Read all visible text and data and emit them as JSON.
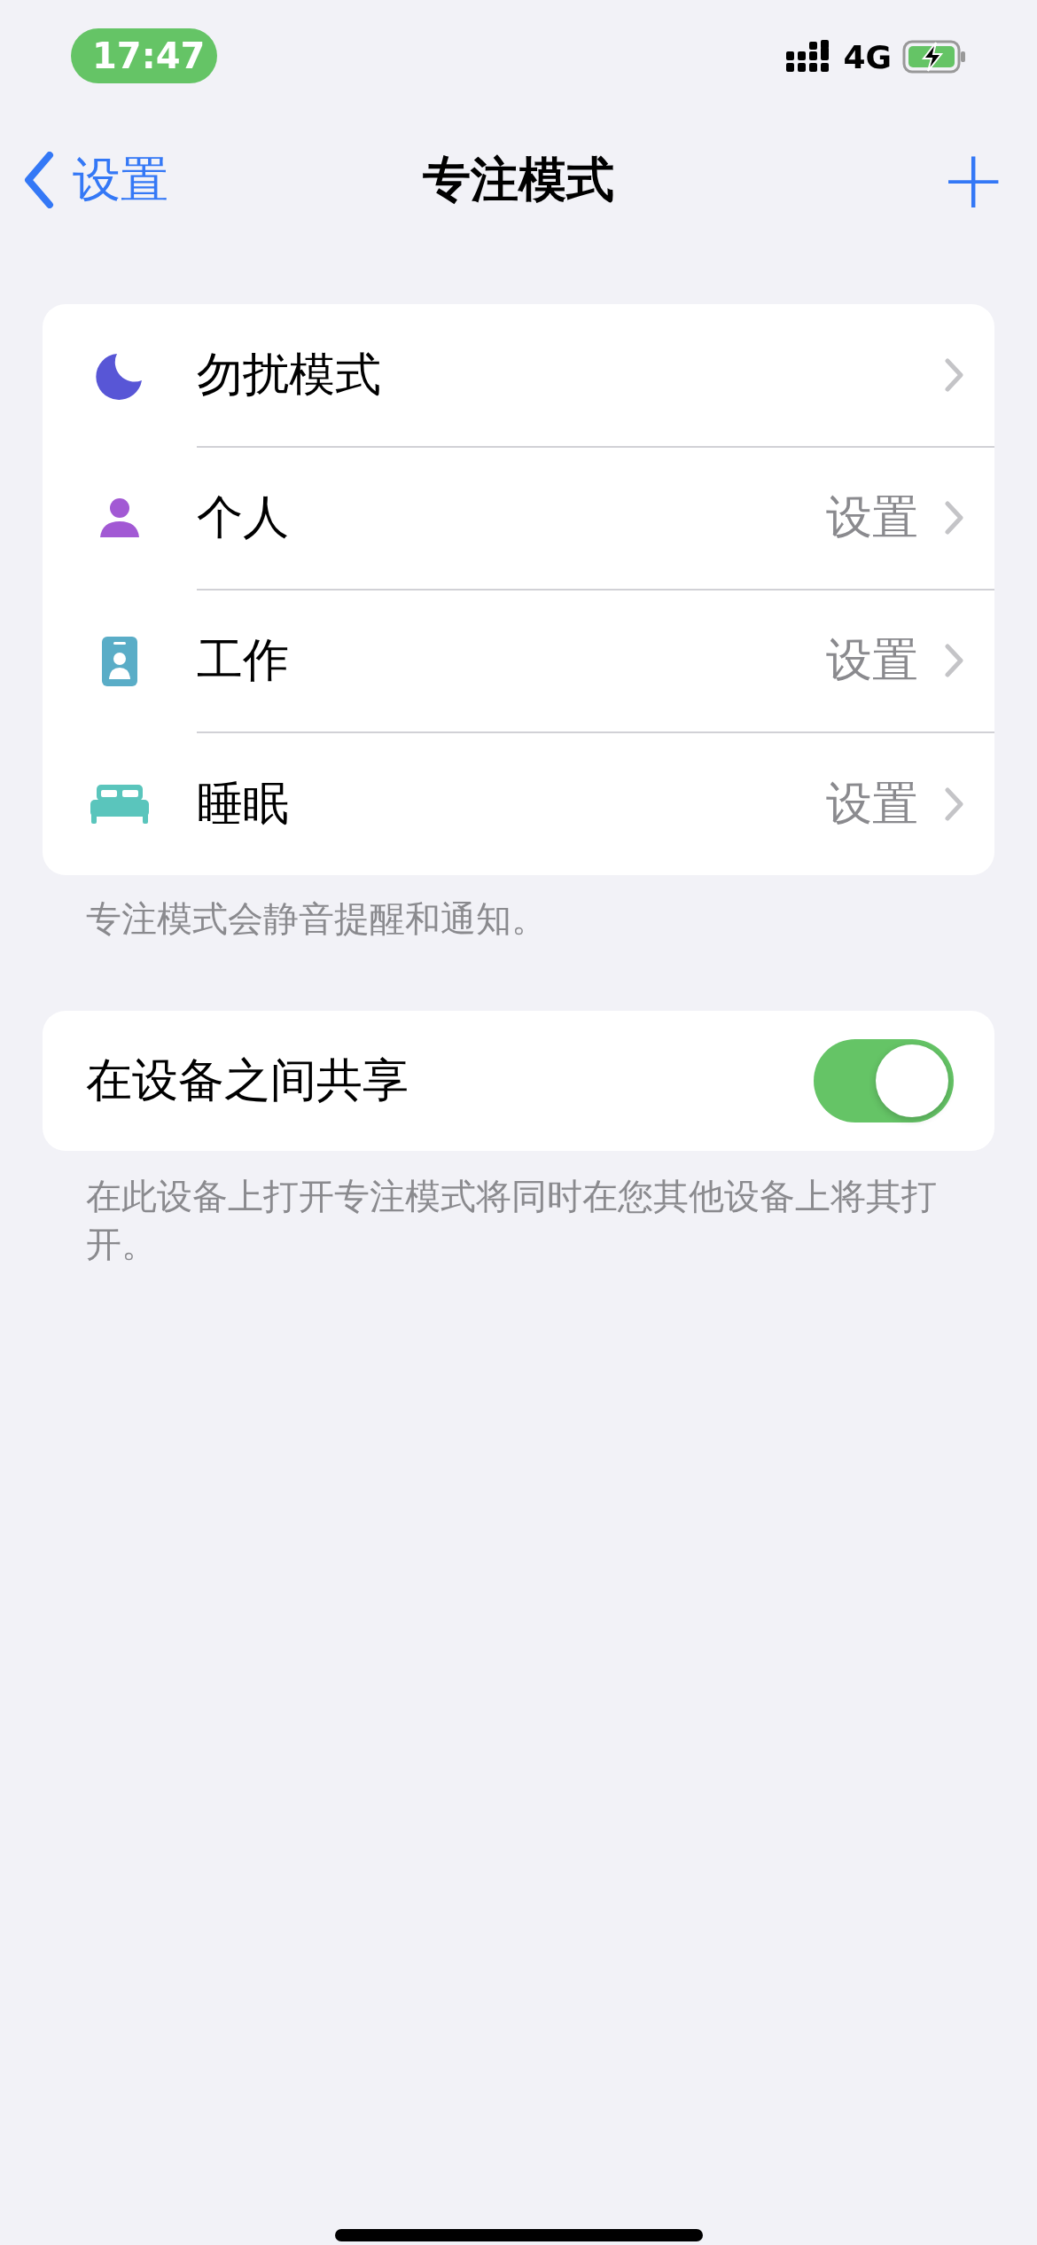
{
  "status_bar": {
    "time": "17:47",
    "network": "4G"
  },
  "nav_bar": {
    "back": "设置",
    "title": "专注模式",
    "add": "+"
  },
  "focus_modes": [
    {
      "label": "勿扰模式",
      "color": "#5856d6"
    },
    {
      "label": "个人",
      "detail": "设置",
      "color": "#a259d4"
    },
    {
      "label": "工作",
      "detail": "设置",
      "color": "#5aadc7"
    },
    {
      "label": "睡眠",
      "detail": "设置",
      "color": "#5ac5bc"
    }
  ],
  "focus_footer": "专注模式会静音提醒和通知。",
  "share": {
    "label": "在设备之间共享",
    "on": true
  },
  "share_footer": "在此设备上打开专注模式将同时在您其他设备上将其打开。"
}
